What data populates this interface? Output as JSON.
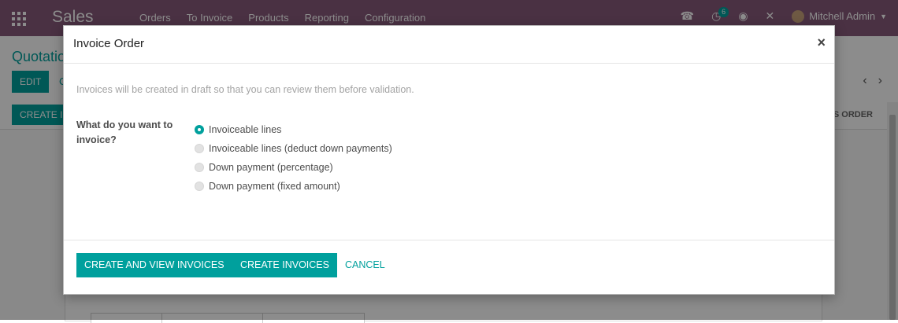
{
  "navbar": {
    "brand": "Sales",
    "menu": [
      "Orders",
      "To Invoice",
      "Products",
      "Reporting",
      "Configuration"
    ],
    "activity_badge": "6",
    "user_name": "Mitchell Admin",
    "icons": [
      "apps-grid-icon",
      "phone-icon",
      "activity-clock-icon",
      "chat-icon",
      "debug-tools-icon",
      "avatar"
    ]
  },
  "control_panel": {
    "title": "Quotatio",
    "edit_label": "EDIT",
    "create_label": "C",
    "statusbar_create_label": "CREATE I",
    "statusbar_right_label": "ES ORDER"
  },
  "modal": {
    "title": "Invoice Order",
    "close_label": "×",
    "info": "Invoices will be created in draft so that you can review them before validation.",
    "question": "What do you want to invoice?",
    "options": [
      {
        "label": "Invoiceable lines",
        "checked": true
      },
      {
        "label": "Invoiceable lines (deduct down payments)",
        "checked": false
      },
      {
        "label": "Down payment (percentage)",
        "checked": false
      },
      {
        "label": "Down payment (fixed amount)",
        "checked": false
      }
    ],
    "buttons": {
      "create_view": "CREATE AND VIEW INVOICES",
      "create": "CREATE INVOICES",
      "cancel": "CANCEL"
    }
  },
  "colors": {
    "navbar": "#875a7b",
    "accent": "#00a09d"
  }
}
